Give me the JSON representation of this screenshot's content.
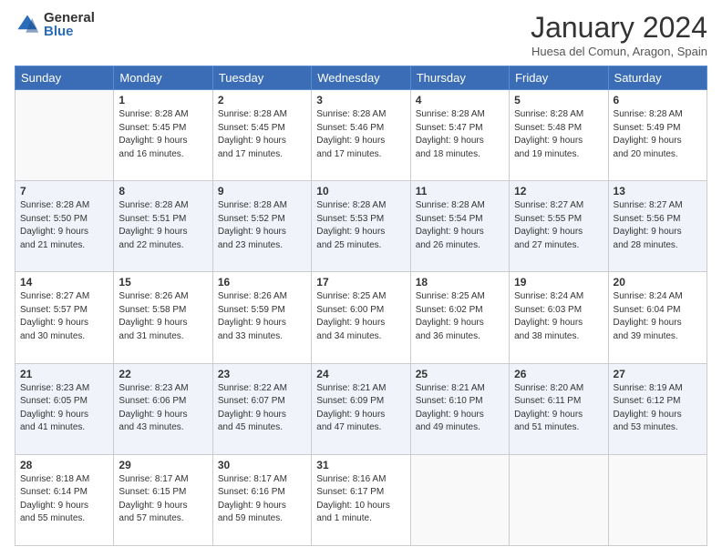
{
  "header": {
    "logo_general": "General",
    "logo_blue": "Blue",
    "month_title": "January 2024",
    "location": "Huesa del Comun, Aragon, Spain"
  },
  "days_of_week": [
    "Sunday",
    "Monday",
    "Tuesday",
    "Wednesday",
    "Thursday",
    "Friday",
    "Saturday"
  ],
  "weeks": [
    [
      {
        "day": "",
        "info": ""
      },
      {
        "day": "1",
        "info": "Sunrise: 8:28 AM\nSunset: 5:45 PM\nDaylight: 9 hours\nand 16 minutes."
      },
      {
        "day": "2",
        "info": "Sunrise: 8:28 AM\nSunset: 5:45 PM\nDaylight: 9 hours\nand 17 minutes."
      },
      {
        "day": "3",
        "info": "Sunrise: 8:28 AM\nSunset: 5:46 PM\nDaylight: 9 hours\nand 17 minutes."
      },
      {
        "day": "4",
        "info": "Sunrise: 8:28 AM\nSunset: 5:47 PM\nDaylight: 9 hours\nand 18 minutes."
      },
      {
        "day": "5",
        "info": "Sunrise: 8:28 AM\nSunset: 5:48 PM\nDaylight: 9 hours\nand 19 minutes."
      },
      {
        "day": "6",
        "info": "Sunrise: 8:28 AM\nSunset: 5:49 PM\nDaylight: 9 hours\nand 20 minutes."
      }
    ],
    [
      {
        "day": "7",
        "info": "Sunrise: 8:28 AM\nSunset: 5:50 PM\nDaylight: 9 hours\nand 21 minutes."
      },
      {
        "day": "8",
        "info": "Sunrise: 8:28 AM\nSunset: 5:51 PM\nDaylight: 9 hours\nand 22 minutes."
      },
      {
        "day": "9",
        "info": "Sunrise: 8:28 AM\nSunset: 5:52 PM\nDaylight: 9 hours\nand 23 minutes."
      },
      {
        "day": "10",
        "info": "Sunrise: 8:28 AM\nSunset: 5:53 PM\nDaylight: 9 hours\nand 25 minutes."
      },
      {
        "day": "11",
        "info": "Sunrise: 8:28 AM\nSunset: 5:54 PM\nDaylight: 9 hours\nand 26 minutes."
      },
      {
        "day": "12",
        "info": "Sunrise: 8:27 AM\nSunset: 5:55 PM\nDaylight: 9 hours\nand 27 minutes."
      },
      {
        "day": "13",
        "info": "Sunrise: 8:27 AM\nSunset: 5:56 PM\nDaylight: 9 hours\nand 28 minutes."
      }
    ],
    [
      {
        "day": "14",
        "info": "Sunrise: 8:27 AM\nSunset: 5:57 PM\nDaylight: 9 hours\nand 30 minutes."
      },
      {
        "day": "15",
        "info": "Sunrise: 8:26 AM\nSunset: 5:58 PM\nDaylight: 9 hours\nand 31 minutes."
      },
      {
        "day": "16",
        "info": "Sunrise: 8:26 AM\nSunset: 5:59 PM\nDaylight: 9 hours\nand 33 minutes."
      },
      {
        "day": "17",
        "info": "Sunrise: 8:25 AM\nSunset: 6:00 PM\nDaylight: 9 hours\nand 34 minutes."
      },
      {
        "day": "18",
        "info": "Sunrise: 8:25 AM\nSunset: 6:02 PM\nDaylight: 9 hours\nand 36 minutes."
      },
      {
        "day": "19",
        "info": "Sunrise: 8:24 AM\nSunset: 6:03 PM\nDaylight: 9 hours\nand 38 minutes."
      },
      {
        "day": "20",
        "info": "Sunrise: 8:24 AM\nSunset: 6:04 PM\nDaylight: 9 hours\nand 39 minutes."
      }
    ],
    [
      {
        "day": "21",
        "info": "Sunrise: 8:23 AM\nSunset: 6:05 PM\nDaylight: 9 hours\nand 41 minutes."
      },
      {
        "day": "22",
        "info": "Sunrise: 8:23 AM\nSunset: 6:06 PM\nDaylight: 9 hours\nand 43 minutes."
      },
      {
        "day": "23",
        "info": "Sunrise: 8:22 AM\nSunset: 6:07 PM\nDaylight: 9 hours\nand 45 minutes."
      },
      {
        "day": "24",
        "info": "Sunrise: 8:21 AM\nSunset: 6:09 PM\nDaylight: 9 hours\nand 47 minutes."
      },
      {
        "day": "25",
        "info": "Sunrise: 8:21 AM\nSunset: 6:10 PM\nDaylight: 9 hours\nand 49 minutes."
      },
      {
        "day": "26",
        "info": "Sunrise: 8:20 AM\nSunset: 6:11 PM\nDaylight: 9 hours\nand 51 minutes."
      },
      {
        "day": "27",
        "info": "Sunrise: 8:19 AM\nSunset: 6:12 PM\nDaylight: 9 hours\nand 53 minutes."
      }
    ],
    [
      {
        "day": "28",
        "info": "Sunrise: 8:18 AM\nSunset: 6:14 PM\nDaylight: 9 hours\nand 55 minutes."
      },
      {
        "day": "29",
        "info": "Sunrise: 8:17 AM\nSunset: 6:15 PM\nDaylight: 9 hours\nand 57 minutes."
      },
      {
        "day": "30",
        "info": "Sunrise: 8:17 AM\nSunset: 6:16 PM\nDaylight: 9 hours\nand 59 minutes."
      },
      {
        "day": "31",
        "info": "Sunrise: 8:16 AM\nSunset: 6:17 PM\nDaylight: 10 hours\nand 1 minute."
      },
      {
        "day": "",
        "info": ""
      },
      {
        "day": "",
        "info": ""
      },
      {
        "day": "",
        "info": ""
      }
    ]
  ]
}
